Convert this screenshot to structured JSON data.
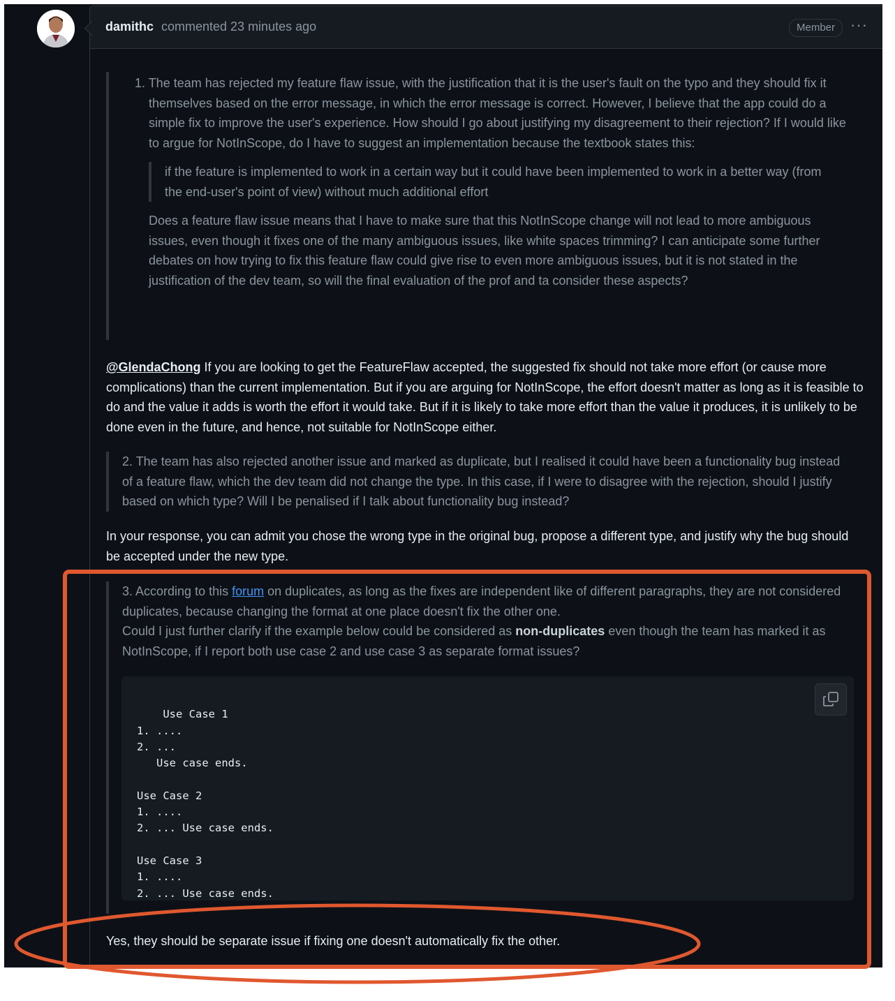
{
  "comment": {
    "author": "damithc",
    "meta": "commented 23 minutes ago",
    "badge": "Member",
    "menu_icon": "kebab-horizontal-icon"
  },
  "q1": {
    "text": "1. The team has rejected my feature flaw issue, with the justification that it is the user's fault on the typo and they should fix it themselves based on the error message, in which the error message is correct. However, I believe that the app could do a simple fix to improve the user's experience. How should I go about justifying my disagreement to their rejection? If I would like to argue for NotInScope, do I have to suggest an implementation because the textbook states this:",
    "nested_quote": "if the feature is implemented to work in a certain way but it could have been implemented to work in a better way (from the end-user's point of view) without much additional effort",
    "followup": "Does a feature flaw issue means that I have to make sure that this NotInScope change will not lead to more ambiguous issues, even though it fixes one of the many ambiguous issues, like white spaces trimming? I can anticipate some further debates on how trying to fix this feature flaw could give rise to even more ambiguous issues, but it is not stated in the justification of the dev team, so will the final evaluation of the prof and ta consider these aspects?"
  },
  "r1": {
    "mention": "@GlendaChong",
    "text": " If you are looking to get the FeatureFlaw accepted, the suggested fix should not take more effort (or cause more complications) than the current implementation. But if you are arguing for NotInScope, the effort doesn't matter as long as it is feasible to do and the value it adds is worth the effort it would take. But if it is likely to take more effort than the value it produces, it is unlikely to be done even in the future, and hence, not suitable for NotInScope either."
  },
  "q2": {
    "text": "2. The team has also rejected another issue and marked as duplicate, but I realised it could have been a functionality bug instead of a feature flaw, which the dev team did not change the type. In this case, if I were to disagree with the rejection, should I justify based on which type? Will I be penalised if I talk about functionality bug instead?"
  },
  "r2": {
    "text": "In your response, you can admit you chose the wrong type in the original bug, propose a different type, and justify why the bug should be accepted under the new type."
  },
  "q3": {
    "text_before_link": "3. According to this ",
    "link": "forum",
    "text_after_link": " on duplicates, as long as the fixes are independent like of different paragraphs, they are not considered duplicates, because changing the format at one place doesn't fix the other one.",
    "text_line2_before": "Could I just further clarify if the example below could be considered as ",
    "bold": "non-duplicates",
    "text_line2_after": " even though the team has marked it as NotInScope, if I report both use case 2 and use case 3 as separate format issues?",
    "code": "Use Case 1\n1. ....\n2. ...\n   Use case ends.\n\nUse Case 2\n1. ....\n2. ... Use case ends.\n\nUse Case 3\n1. ....\n2. ... Use case ends.",
    "copy_icon": "copy-icon"
  },
  "r3": {
    "text": "Yes, they should be separate issue if fixing one doesn't automatically fix the other."
  },
  "annotation": {
    "color": "#e0582f"
  }
}
